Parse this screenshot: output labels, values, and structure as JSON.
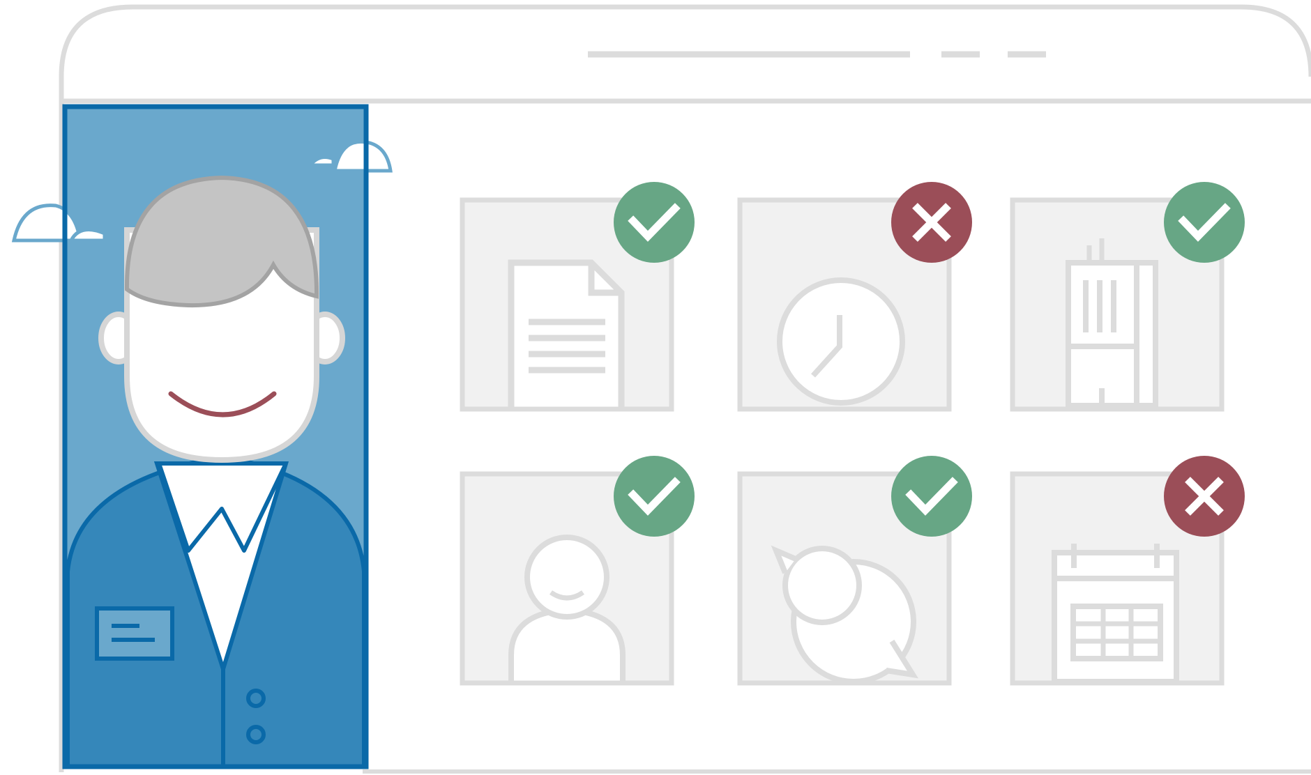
{
  "colors": {
    "frame": "#dcdcdc",
    "tile_fill": "#f1f1f1",
    "panel_light": "#6aa8cc",
    "panel_border": "#0a69a8",
    "suit": "#3587ba",
    "hair": "#c4c4c4",
    "hair_outline": "#a3a3a3",
    "skin": "#ffffff",
    "skin_outline": "#d6d6d6",
    "smile": "#9b4e58",
    "approved": "#67a685",
    "denied": "#9b4e58"
  },
  "browser": {
    "address_bar_shown": true,
    "window_controls": 2
  },
  "agent": {
    "name_badge_shown": true,
    "buttons": 2
  },
  "tiles": [
    {
      "icon": "document-icon",
      "status": "approved"
    },
    {
      "icon": "clock-icon",
      "status": "denied"
    },
    {
      "icon": "building-icon",
      "status": "approved"
    },
    {
      "icon": "person-icon",
      "status": "approved"
    },
    {
      "icon": "chat-bubbles-icon",
      "status": "approved"
    },
    {
      "icon": "calendar-icon",
      "status": "denied"
    }
  ]
}
